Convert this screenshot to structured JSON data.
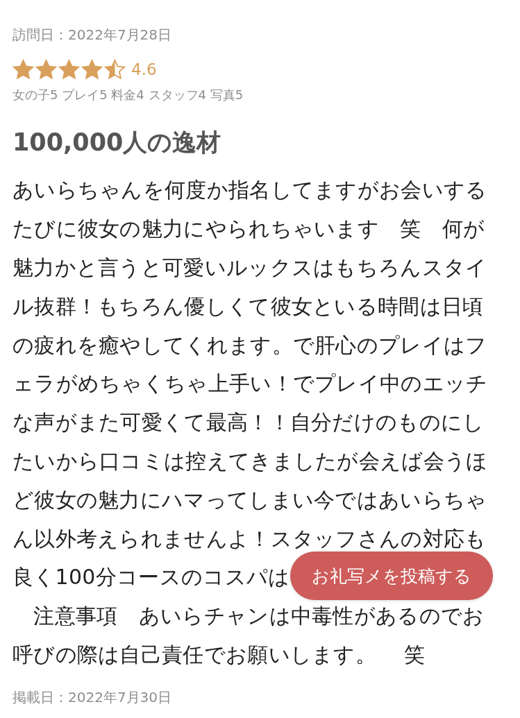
{
  "review": {
    "visit_date": "訪問日：2022年7月28日",
    "stars": 4.5,
    "score": "4.6",
    "sub_scores": "女の子5 プレイ5 料金4 スタッフ4 写真5",
    "title": "100,000人の逸材",
    "lines": [
      "あいらちゃんを何度か指名してますがお会いする",
      "たびに彼女の魅力にやられちゃいます　笑　何が",
      "魅力かと言うと可愛いルックスはもちろんスタイ",
      "ル抜群！もちろん優しくて彼女といる時間は日頃",
      "の疲れを癒やしてくれます。で肝心のプレイはフ",
      "ェラがめちゃくちゃ上手い！でプレイ中のエッチ",
      "な声がまた可愛くて最高！！自分だけのものにし",
      "たいから口コミは控えてきましたが会えば会うほ",
      "ど彼女の魅力にハマってしまい今ではあいらちゃ",
      "ん以外考えられませんよ！スタッフさんの対応も",
      "良く100分コースのコスパは",
      "　注意事項　あいらチャンは中毒性があるのでお",
      "呼びの際は自己責任でお願いします。　 笑"
    ],
    "post_date": "掲載日：2022年7月30日"
  },
  "floating_button": {
    "label": "お礼写メを投稿する"
  }
}
